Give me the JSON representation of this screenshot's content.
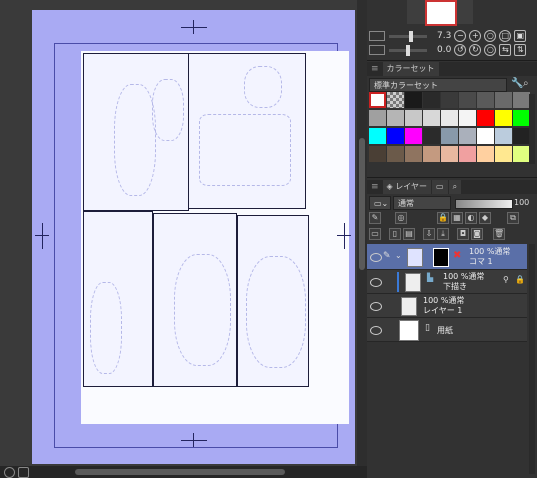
{
  "navigator": {
    "zoom_value": "7.3",
    "rotate_value": "0.0"
  },
  "color_set": {
    "tab_label": "カラーセット",
    "set_name": "標準カラーセット",
    "swatches": [
      "#ffffff",
      "#888888",
      "#1a1a1a",
      "#2a2a2a",
      "#3a3a3a",
      "#4a4a4a",
      "#5a5a5a",
      "#6a6a6a",
      "#7a7a7a",
      "#a0a0a0",
      "#b5b5b5",
      "#c8c8c8",
      "#d8d8d8",
      "#e8e8e8",
      "#f4f4f4",
      "#ff0000",
      "#ffff00",
      "#00ff00",
      "#00ffff",
      "#0000ff",
      "#ff00ff",
      "#2b2b2b",
      "#8899aa",
      "#aab0bb",
      "#ffffff",
      "#bbccdd",
      "#222222",
      "#4a3f35",
      "#6b5a4a",
      "#8f7460",
      "#c49a80",
      "#e8b8a0",
      "#f0a0a0",
      "#ffd0a0",
      "#ffe890",
      "#e0ff80"
    ]
  },
  "layer_panel": {
    "tab_label": "レイヤー",
    "blend_mode": "通常",
    "opacity": "100",
    "layers": [
      {
        "line1": "100 %通常",
        "line2": "コマ 1"
      },
      {
        "line1": "100 %通常",
        "line2": "用紙"
      }
    ],
    "sublayers": [
      {
        "line1": "100 %通常",
        "line2": "下描き"
      },
      {
        "line1": "100 %通常",
        "line2": "レイヤー 1"
      }
    ]
  },
  "colors": {
    "page_blue": "#a9aaf3",
    "selected_layer": "#5a6fa8",
    "app_dark": "#323232"
  }
}
